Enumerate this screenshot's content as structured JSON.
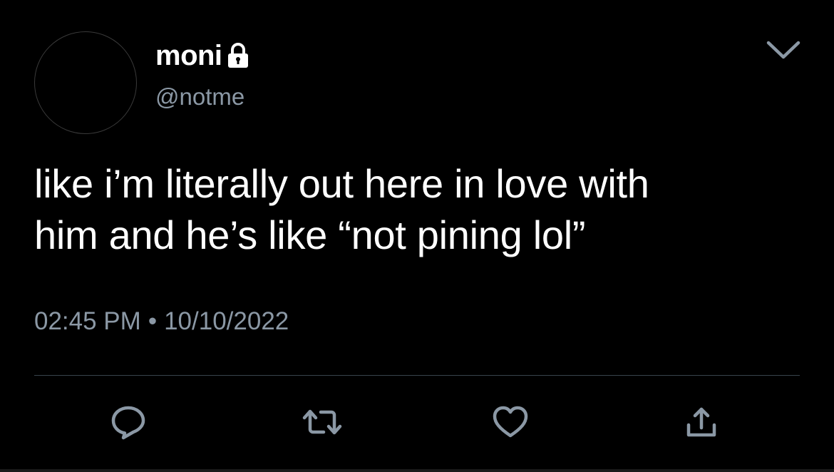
{
  "tweet": {
    "author": {
      "display_name": "moni",
      "handle": "@notme",
      "protected_icon": "lock-icon"
    },
    "text_lines": [
      "like i’m literally out here in love with",
      "him and he’s like “not pining lol”"
    ],
    "time": "02:45 PM",
    "separator": "•",
    "date": "10/10/2022",
    "menu_icon": "chevron-down-icon",
    "actions": {
      "reply_icon": "reply-icon",
      "retweet_icon": "retweet-icon",
      "like_icon": "heart-icon",
      "share_icon": "share-icon"
    }
  },
  "colors": {
    "background": "#000000",
    "text_primary": "#ffffff",
    "text_secondary": "#8b98a5",
    "divider": "#38444d",
    "icon": "#8b98a5"
  }
}
